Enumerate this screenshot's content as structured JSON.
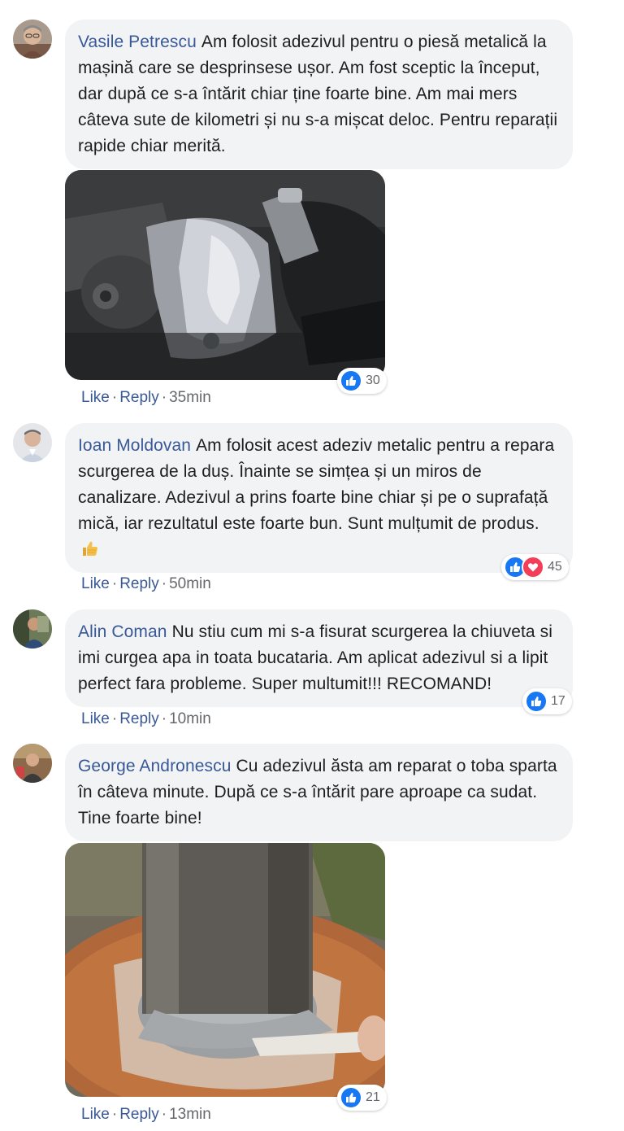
{
  "comments": [
    {
      "author": "Vasile Petrescu",
      "text": "Am folosit adezivul pentru o piesă metalică la mașină care se desprinsese ușor. Am fost sceptic la început, dar după ce s-a întărit chiar ține foarte bine. Am mai mers câteva sute de kilometri și nu s-a mișcat deloc. Pentru reparații rapide chiar merită.",
      "reaction_count": "30",
      "reactions": [
        "like-icon"
      ],
      "actions": {
        "like": "Like",
        "reply": "Reply",
        "separator": "·",
        "time": "35min"
      }
    },
    {
      "author": "Ioan Moldovan",
      "text": "Am folosit acest adeziv metalic pentru a repara scurgerea de la duș. Înainte se simțea și un miros de canalizare. Adezivul a prins foarte bine chiar și pe o suprafață mică, iar rezultatul este foarte bun. Sunt mulțumit de produs.",
      "emoji": "thumbs-up-emoji",
      "reaction_count": "45",
      "reactions": [
        "like-icon",
        "love-icon"
      ],
      "actions": {
        "like": "Like",
        "reply": "Reply",
        "separator": "·",
        "time": "50min"
      }
    },
    {
      "author": "Alin Coman",
      "text": "Nu stiu cum mi s-a fisurat scurgerea la chiuveta si imi curgea apa in toata bucataria. Am aplicat adezivul si a lipit perfect fara probleme. Super multumit!!! RECOMAND!",
      "reaction_count": "17",
      "reactions": [
        "like-icon"
      ],
      "actions": {
        "like": "Like",
        "reply": "Reply",
        "separator": "·",
        "time": "10min"
      }
    },
    {
      "author": "George Andronescu",
      "text": "Cu adezivul ăsta am reparat o toba sparta în câteva minute. După ce s-a întărit pare aproape ca sudat. Tine foarte bine!",
      "reaction_count": "21",
      "reactions": [
        "like-icon"
      ],
      "actions": {
        "like": "Like",
        "reply": "Reply",
        "separator": "·",
        "time": "13min"
      }
    }
  ],
  "colors": {
    "author": "#385898",
    "bubble": "#f2f3f5",
    "like": "#1877f2",
    "love": "#f33e58",
    "meta": "#65676b"
  }
}
